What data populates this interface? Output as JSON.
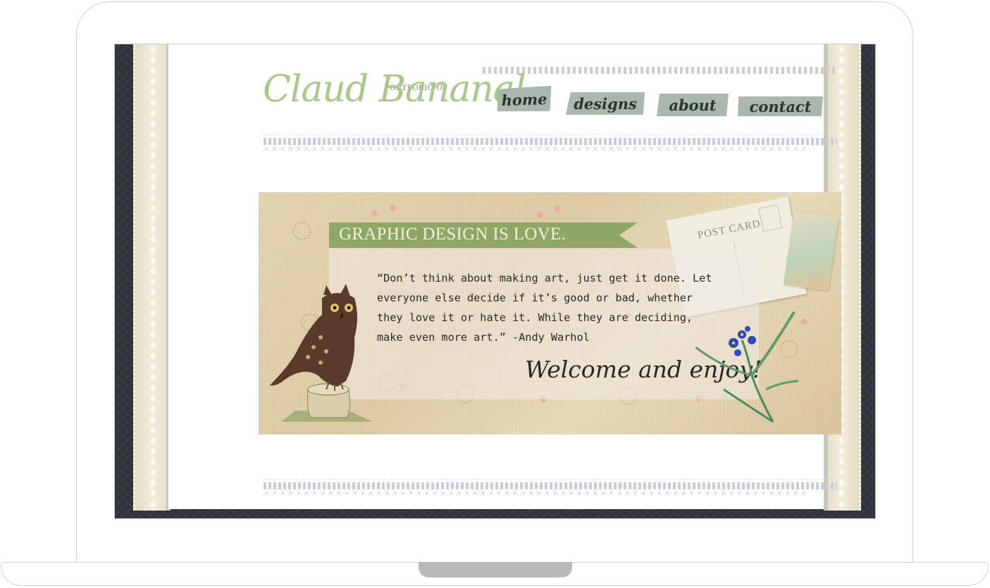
{
  "site": {
    "tagline_small": "PORTFOLIO OF",
    "name": "Claud Bananal"
  },
  "nav": {
    "home": "home",
    "designs": "designs",
    "about": "about",
    "contact": "contact"
  },
  "banner": {
    "heading": "GRAPHIC DESIGN IS LOVE.",
    "quote_lines": [
      "“Don’t think about making art, just get it done. Let",
      "everyone else decide if it’s good or bad, whether",
      "they love it or hate it. While they are deciding,",
      "make even more art.” -Andy Warhol"
    ],
    "welcome": "Welcome and enjoy!",
    "postcard_text": "POST CARD"
  },
  "icons": [
    "owl-illustration",
    "postcard-illustration",
    "flower-illustration"
  ],
  "colors": {
    "brand_green": "#a7c98a",
    "tag_green": "#8fa766",
    "nav_tape": "#a9b7ac",
    "frame_dark": "#2f343b"
  }
}
